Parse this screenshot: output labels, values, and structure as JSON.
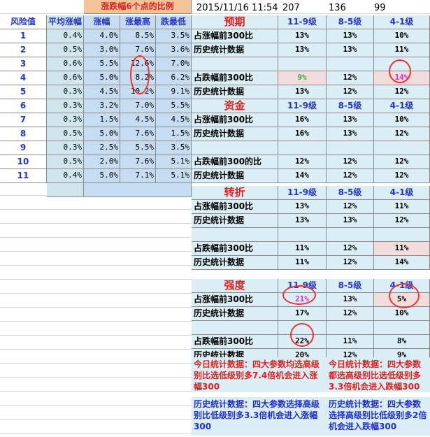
{
  "top": {
    "title": "涨跌幅6个点的比例",
    "datetime": "2015/11/16 11:54",
    "n1": "207",
    "n2": "136",
    "n3": "99"
  },
  "left_table": {
    "headers": [
      "风险值",
      "平均涨幅",
      "涨幅",
      "涨最高",
      "跌最低"
    ],
    "rows": [
      [
        "1",
        "0.4%",
        "4.0%",
        "8.5%",
        "3.5%"
      ],
      [
        "2",
        "0.5%",
        "3.0%",
        "7.6%",
        "3.6%"
      ],
      [
        "3",
        "0.6%",
        "5.5%",
        "12.6%",
        "7.0%"
      ],
      [
        "4",
        "0.6%",
        "5.0%",
        "8.2%",
        "6.2%"
      ],
      [
        "5",
        "0.3%",
        "4.5%",
        "10.2%",
        "9.1%"
      ],
      [
        "6",
        "0.3%",
        "3.2%",
        "7.0%",
        "5.5%"
      ],
      [
        "7",
        "0.3%",
        "1.5%",
        "4.5%",
        "4.5%"
      ],
      [
        "8",
        "0.5%",
        "5.0%",
        "7.6%",
        "1.5%"
      ],
      [
        "9",
        "0.3%",
        "2.5%",
        "5.5%",
        "3.5%"
      ],
      [
        "10",
        "0.5%",
        "2.0%",
        "7.6%",
        "5.1%"
      ],
      [
        "11",
        "0.4%",
        "5.0%",
        "7.1%",
        "5.1%"
      ]
    ]
  },
  "sections": [
    {
      "title": "预期",
      "cols": [
        "11-9级",
        "8-5级",
        "4-1级"
      ],
      "rows": [
        {
          "label": "占涨幅前300比",
          "vals": [
            "13%",
            "13%",
            "10%"
          ]
        },
        {
          "label": "历史统计数据",
          "vals": [
            "13%",
            "13%",
            "11%"
          ]
        },
        {
          "label": "",
          "vals": [
            "",
            "",
            ""
          ]
        },
        {
          "label": "占跌幅前300比",
          "vals": [
            "9%",
            "12%",
            "14%"
          ]
        },
        {
          "label": "历史统计数据",
          "vals": [
            "13%",
            "12%",
            "12%"
          ]
        }
      ]
    },
    {
      "title": "资金",
      "cols": [
        "11-9级",
        "8-5级",
        "4-1级"
      ],
      "rows": [
        {
          "label": "占涨幅前300比",
          "vals": [
            "16%",
            "13%",
            "10%"
          ]
        },
        {
          "label": "历史统计数据",
          "vals": [
            "16%",
            "13%",
            "12%"
          ]
        },
        {
          "label": "",
          "vals": [
            "",
            "",
            ""
          ]
        },
        {
          "label": "占跌幅前300的比",
          "vals": [
            "12%",
            "12%",
            "12%"
          ]
        },
        {
          "label": "历史统计数据",
          "vals": [
            "14%",
            "12%",
            "12%"
          ]
        }
      ]
    },
    {
      "title": "转折",
      "cols": [
        "11-9级",
        "8-5级",
        "4-1级"
      ],
      "rows": [
        {
          "label": "占涨幅前300比",
          "vals": [
            "13%",
            "12%",
            "11%"
          ]
        },
        {
          "label": "历史统计数据",
          "vals": [
            "13%",
            "13%",
            "12%"
          ]
        },
        {
          "label": "",
          "vals": [
            "",
            "",
            ""
          ]
        },
        {
          "label": "占跌幅前300比",
          "vals": [
            "11%",
            "12%",
            "11%"
          ]
        },
        {
          "label": "历史统计数据",
          "vals": [
            "11%",
            "12%",
            "14%"
          ]
        }
      ]
    },
    {
      "title": "强度",
      "cols": [
        "11-9级",
        "8-5级",
        "4-1级"
      ],
      "rows": [
        {
          "label": "占涨幅前300比",
          "vals": [
            "21%",
            "13%",
            "5%"
          ]
        },
        {
          "label": "历史统计数据",
          "vals": [
            "17%",
            "12%",
            "10%"
          ]
        },
        {
          "label": "",
          "vals": [
            "",
            "",
            ""
          ]
        },
        {
          "label": "占跌幅前300比",
          "vals": [
            "22%",
            "11%",
            "8%"
          ]
        },
        {
          "label": "历史统计数据",
          "vals": [
            "20%",
            "12%",
            "9%"
          ]
        }
      ]
    }
  ],
  "notes": {
    "today_up": "今日统计数据：四大参数均选高级别比选低级别多7.4倍机会进入涨幅300",
    "today_down": "今日统计数据：四大参数都选高级别比选低级别多3.3倍机会进入跌幅300",
    "hist_up": "历史统计数据：四大参数选择高级别比低级别多3.3倍机会进入涨幅300",
    "hist_down": "历史统计数据：四大参数选择高级别比低级别多2倍机会进入跌幅300"
  },
  "colors": {
    "header_blue": "#2433c9",
    "title_red": "#e02020",
    "highlight_green": "#2bb24c",
    "highlight_magenta": "#d42bd4",
    "circle_red": "#e33333"
  }
}
